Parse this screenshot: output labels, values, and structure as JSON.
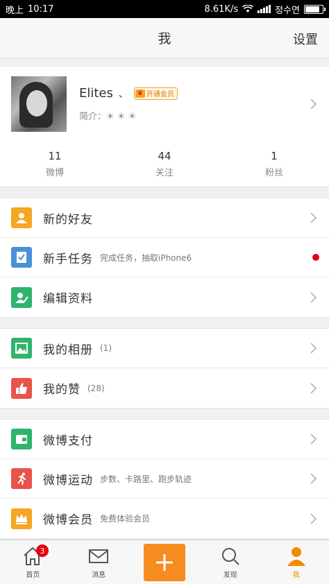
{
  "status_bar": {
    "left_label": "晚上",
    "time": "10:17",
    "net_speed": "8.61K/s",
    "carrier": "정수연",
    "battery_level": 0.85
  },
  "header": {
    "title": "我",
    "settings": "设置"
  },
  "profile": {
    "name": "Elites",
    "name_mark": "、",
    "vip_badge": "开通会员",
    "intro": "简介：☀ ☀ ☀"
  },
  "stats": [
    {
      "num": "11",
      "label": "微博"
    },
    {
      "num": "44",
      "label": "关注"
    },
    {
      "num": "1",
      "label": "粉丝"
    }
  ],
  "menu_groups": [
    [
      {
        "label": "新的好友",
        "sub": "",
        "icon": "person-icon",
        "color": "#f5a623"
      },
      {
        "label": "新手任务",
        "sub": "完成任务，抽取iPhone6",
        "icon": "task-icon",
        "color": "#4a90d9",
        "dot": true
      },
      {
        "label": "编辑资料",
        "sub": "",
        "icon": "edit-profile-icon",
        "color": "#2fb36d"
      }
    ],
    [
      {
        "label": "我的相册",
        "sub": "(1)",
        "icon": "album-icon",
        "color": "#2fb36d"
      },
      {
        "label": "我的赞",
        "sub": "(28)",
        "icon": "thumbs-up-icon",
        "color": "#e8534a"
      }
    ],
    [
      {
        "label": "微博支付",
        "sub": "",
        "icon": "wallet-icon",
        "color": "#2fb36d"
      },
      {
        "label": "微博运动",
        "sub": "步数、卡路里、跑步轨迹",
        "icon": "running-icon",
        "color": "#e8534a"
      },
      {
        "label": "微博会员",
        "sub": "免费体验会员",
        "icon": "vip-crown-icon",
        "color": "#f5a623"
      }
    ]
  ],
  "tabs": [
    {
      "label": "首页",
      "badge": "3"
    },
    {
      "label": "消息"
    },
    {
      "label": ""
    },
    {
      "label": "发现"
    },
    {
      "label": "我"
    }
  ],
  "colors": {
    "accent": "#f68b1f",
    "badge_red": "#e60012"
  }
}
